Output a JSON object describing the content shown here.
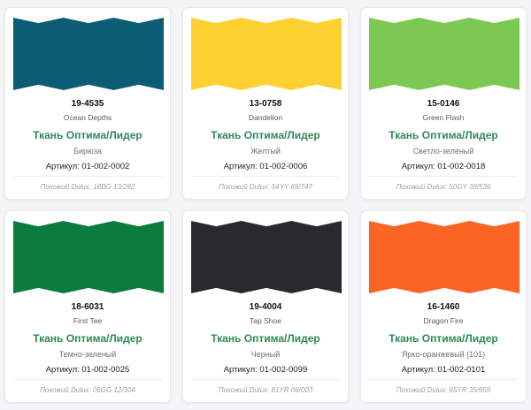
{
  "fabric_label": "Ткань Оптима/Лидер",
  "article_prefix": "Артикул: ",
  "dulux_prefix": "Похожий Dulux: ",
  "colors": {
    "accent_green": "#2e8b57"
  },
  "cards": [
    {
      "code": "19-4535",
      "english_name": "Ocean Depths",
      "russian_name": "Бирюза",
      "article": "Артикул: 01-002-0002",
      "dulux": "Похожий Dulux: 16BG 13/282",
      "color": "#0d5c75"
    },
    {
      "code": "13-0758",
      "english_name": "Dandelion",
      "russian_name": "Желтый",
      "article": "Артикул: 01-002-0006",
      "dulux": "Похожий Dulux: 54YY 69/747",
      "color": "#fdd132"
    },
    {
      "code": "15-0146",
      "english_name": "Green Flash",
      "russian_name": "Светло-зеленый",
      "article": "Артикул: 01-002-0018",
      "dulux": "Похожий Dulux: 50GY 39/536",
      "color": "#7bc852"
    },
    {
      "code": "18-6031",
      "english_name": "First Tee",
      "russian_name": "Темно-зеленый",
      "article": "Артикул: 01-002-0025",
      "dulux": "Похожий Dulux: 06GG 12/304",
      "color": "#0b7b3e"
    },
    {
      "code": "19-4004",
      "english_name": "Tap Shoe",
      "russian_name": "Черный",
      "article": "Артикул: 01-002-0099",
      "dulux": "Похожий Dulux: 81YR 06/003",
      "color": "#282a2c"
    },
    {
      "code": "16-1460",
      "english_name": "Dragon Fire",
      "russian_name": "Ярко-оранжевый (101)",
      "article": "Артикул: 01-002-0101",
      "dulux": "Похожий Dulux: 65YR 35/659",
      "color": "#fc6424"
    }
  ]
}
